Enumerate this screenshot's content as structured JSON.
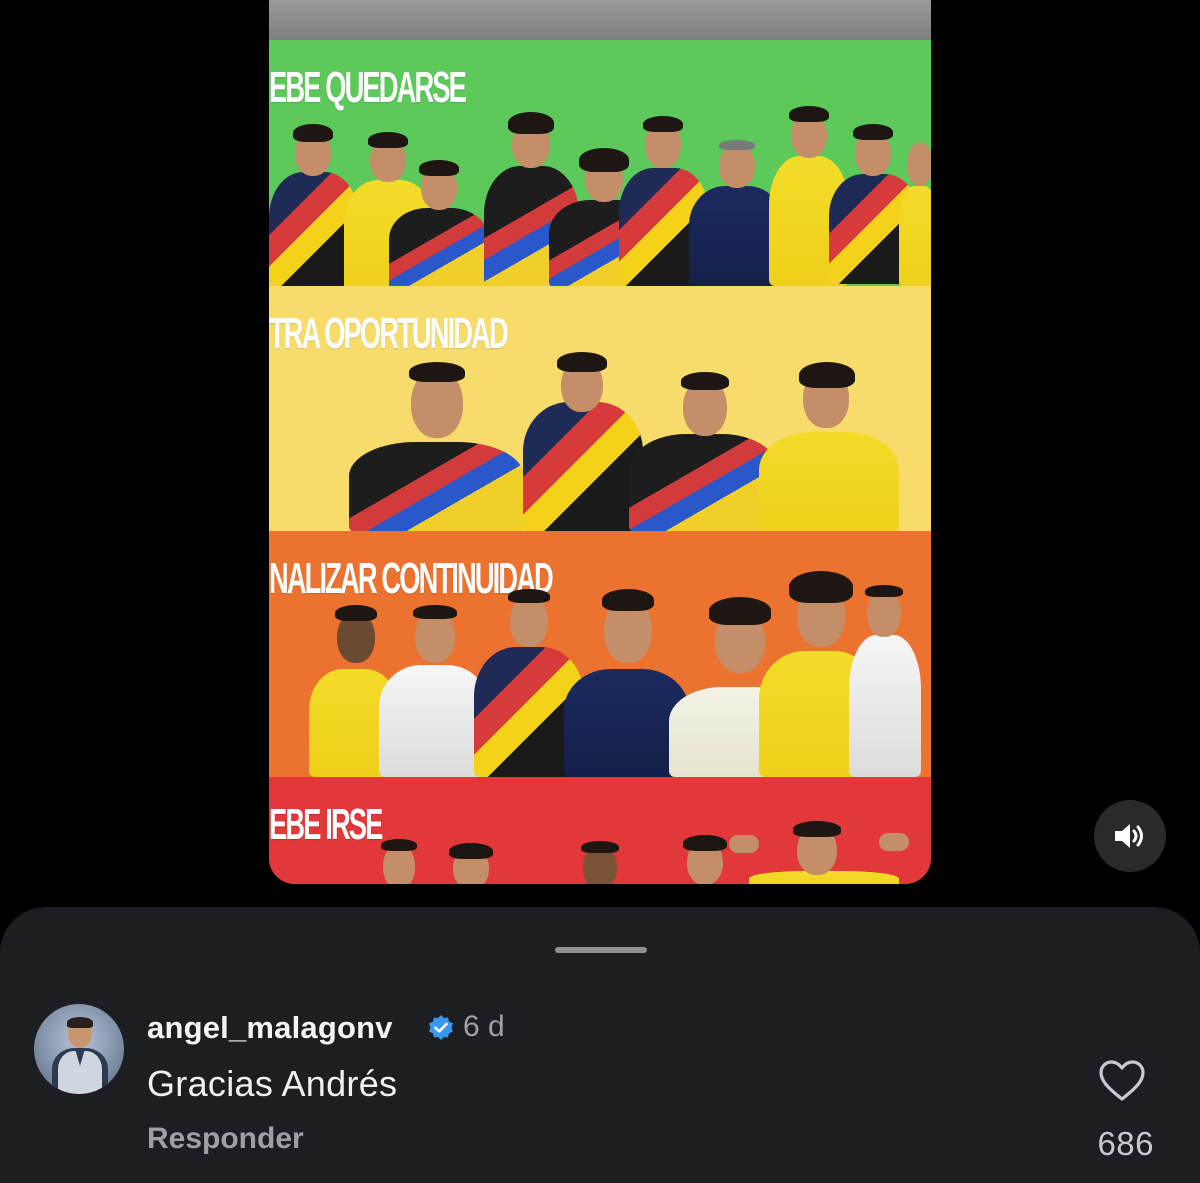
{
  "media": {
    "tiers": [
      {
        "label": "EBE QUEDARSE",
        "color": "#5cc95a"
      },
      {
        "label": "TRA OPORTUNIDAD",
        "color": "#f7dc6b"
      },
      {
        "label": "NALIZAR CONTINUIDAD",
        "color": "#ec7230"
      },
      {
        "label": "EBE IRSE",
        "color": "#e2383a"
      }
    ],
    "sound_icon": "speaker-volume-icon"
  },
  "comment": {
    "username": "angel_malagonv",
    "verified_icon": "verified-badge-icon",
    "timestamp": "6 d",
    "text": "Gracias Andrés",
    "reply_label": "Responder",
    "like_icon": "heart-outline-icon",
    "like_count": "686"
  },
  "colors": {
    "sheet_background": "#1c1e21",
    "verified_blue": "#3897f0",
    "page_background": "#000000"
  }
}
